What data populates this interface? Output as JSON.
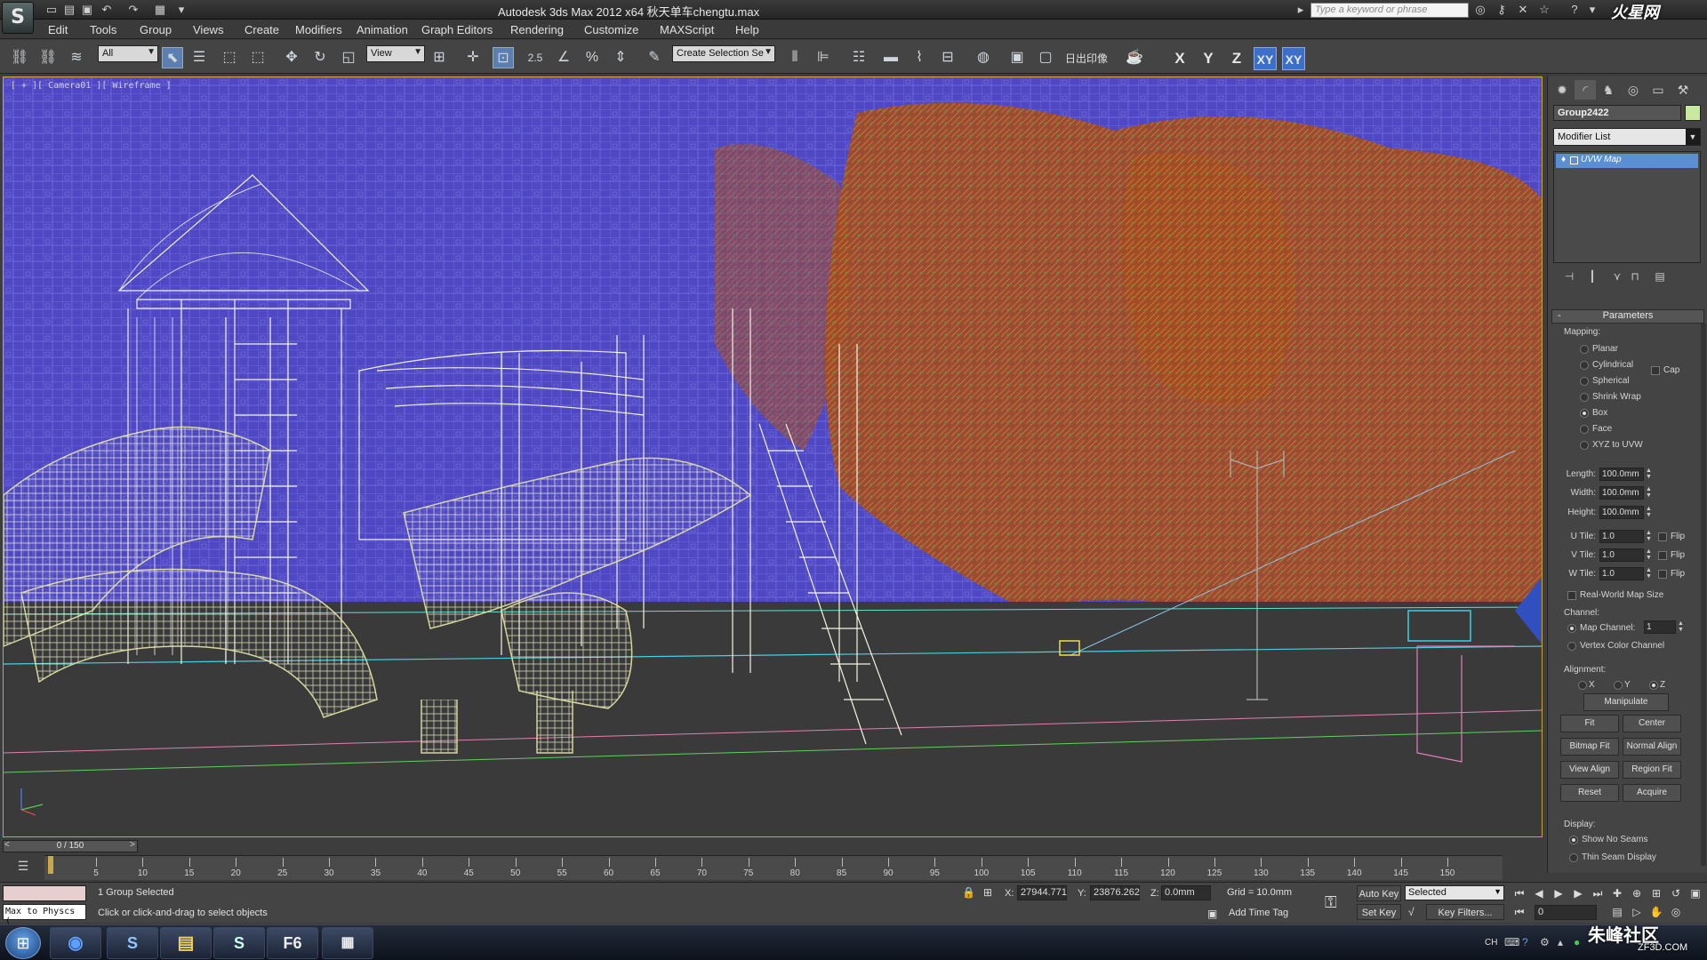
{
  "window": {
    "title": "Autodesk 3ds Max  2012 x64     秋天单车chengtu.max",
    "search_placeholder": "Type a keyword or phrase",
    "watermark": "火星网",
    "app_logo_letter": "S"
  },
  "quick_access": [
    "new-icon",
    "open-icon",
    "save-icon",
    "undo-icon",
    "redo-icon",
    "project-icon"
  ],
  "menu": [
    "Edit",
    "Tools",
    "Group",
    "Views",
    "Create",
    "Modifiers",
    "Animation",
    "Graph Editors",
    "Rendering",
    "Customize",
    "MAXScript",
    "Help"
  ],
  "toolbar": {
    "selection_filter": "All",
    "reference_coord": "View",
    "snap_label": "2.5",
    "named_selection": "Create Selection Se",
    "text_tool_label": "日出印像",
    "axis_x": "X",
    "axis_y": "Y",
    "axis_z": "Z",
    "axis_xy": "XY",
    "axis_xy2": "XY"
  },
  "viewport": {
    "label": "[ + ][ Camera01 ][ Wireframe ]"
  },
  "command_panel": {
    "object_name": "Group2422",
    "object_color": "#c8e8a0",
    "modifier_list": "Modifier List",
    "stack_item": "UVW Map",
    "rollout_title": "Parameters",
    "mapping_label": "Mapping:",
    "mapping_options": [
      "Planar",
      "Cylindrical",
      "Spherical",
      "Shrink Wrap",
      "Box",
      "Face",
      "XYZ to UVW"
    ],
    "mapping_selected": "Box",
    "cap_label": "Cap",
    "length_label": "Length:",
    "length_value": "100.0mm",
    "width_label": "Width:",
    "width_value": "100.0mm",
    "height_label": "Height:",
    "height_value": "100.0mm",
    "u_tile_label": "U Tile:",
    "u_tile_value": "1.0",
    "v_tile_label": "V Tile:",
    "v_tile_value": "1.0",
    "w_tile_label": "W Tile:",
    "w_tile_value": "1.0",
    "flip_label": "Flip",
    "real_world_label": "Real-World Map Size",
    "channel_label": "Channel:",
    "map_channel_label": "Map Channel:",
    "map_channel_value": "1",
    "vertex_color_label": "Vertex Color Channel",
    "alignment_label": "Alignment:",
    "align_x": "X",
    "align_y": "Y",
    "align_z": "Z",
    "manipulate": "Manipulate",
    "fit": "Fit",
    "center": "Center",
    "bitmap_fit": "Bitmap Fit",
    "normal_align": "Normal Align",
    "view_align": "View Align",
    "region_fit": "Region Fit",
    "reset": "Reset",
    "acquire": "Acquire",
    "display_label": "Display:",
    "show_no_seams": "Show No Seams",
    "thin_seam": "Thin Seam Display"
  },
  "timeline": {
    "slider": "0 / 150",
    "ticks": [
      "5",
      "10",
      "15",
      "20",
      "25",
      "30",
      "35",
      "40",
      "45",
      "50",
      "55",
      "60",
      "65",
      "70",
      "75",
      "80",
      "85",
      "90",
      "95",
      "100",
      "105",
      "110",
      "115",
      "120",
      "125",
      "130",
      "135",
      "140",
      "145",
      "150"
    ]
  },
  "status": {
    "script_text": "Max to Physcs (",
    "selection": "1 Group Selected",
    "prompt": "Click or click-and-drag to select objects",
    "x_label": "X:",
    "x_value": "27944.771",
    "y_label": "Y:",
    "y_value": "23876.262",
    "z_label": "Z:",
    "z_value": "0.0mm",
    "grid": "Grid = 10.0mm",
    "add_time_tag": "Add Time Tag",
    "auto_key": "Auto Key",
    "set_key": "Set Key",
    "key_mode": "Selected",
    "key_filters": "Key Filters...",
    "frame": "0"
  },
  "taskbar": {
    "apps": [
      "S",
      "",
      "S",
      "F6",
      ""
    ],
    "tray": "CH",
    "watermark_cn": "朱峰社区",
    "watermark_url": "ZF3D.COM"
  }
}
